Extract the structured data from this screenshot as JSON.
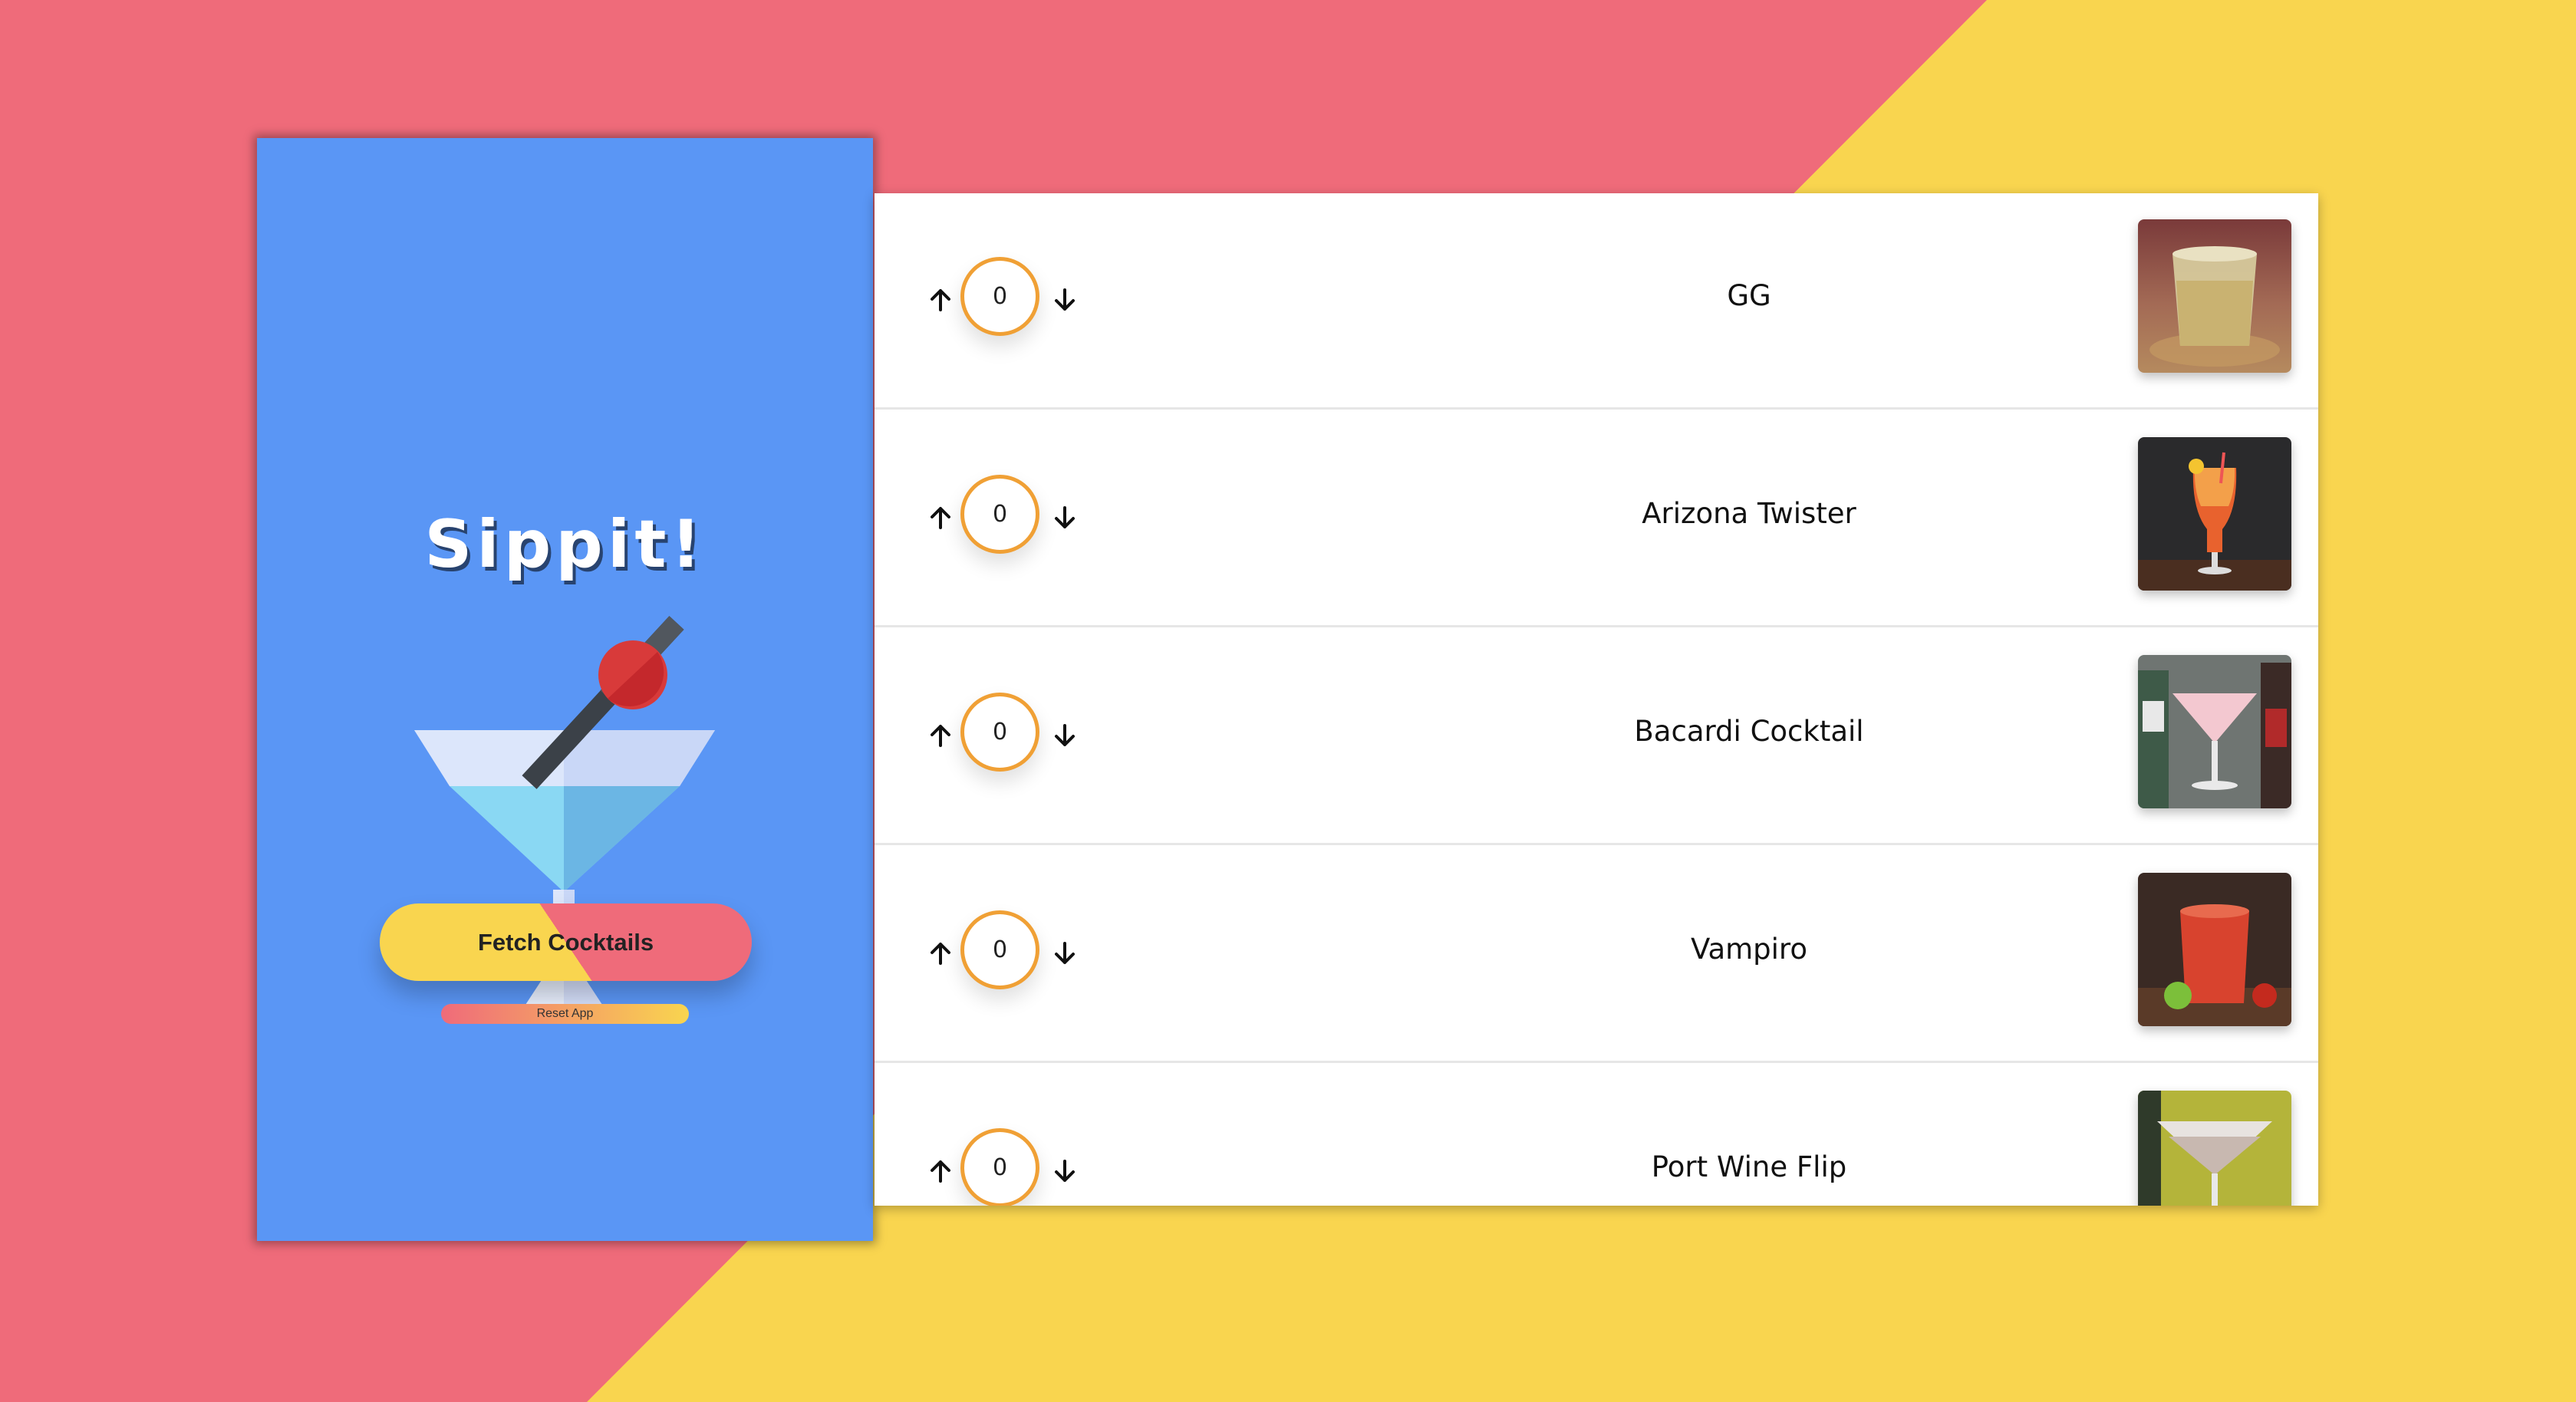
{
  "app": {
    "title": "Sippit!",
    "fetch_button_label": "Fetch Cocktails",
    "reset_button_label": "Reset App"
  },
  "colors": {
    "background_pink": "#ef6b7a",
    "background_yellow": "#f9d54f",
    "sidebar_blue": "#5a96f5",
    "vote_ring_orange": "#f0a035"
  },
  "icons": {
    "logo": "martini-glass-icon",
    "vote_up": "arrow-up-icon",
    "vote_down": "arrow-down-icon"
  },
  "cocktails": [
    {
      "name": "GG",
      "votes": "0",
      "thumbnail": "cocktail-photo"
    },
    {
      "name": "Arizona Twister",
      "votes": "0",
      "thumbnail": "cocktail-photo"
    },
    {
      "name": "Bacardi Cocktail",
      "votes": "0",
      "thumbnail": "cocktail-photo"
    },
    {
      "name": "Vampiro",
      "votes": "0",
      "thumbnail": "cocktail-photo"
    },
    {
      "name": "Port Wine Flip",
      "votes": "0",
      "thumbnail": "cocktail-photo"
    }
  ]
}
